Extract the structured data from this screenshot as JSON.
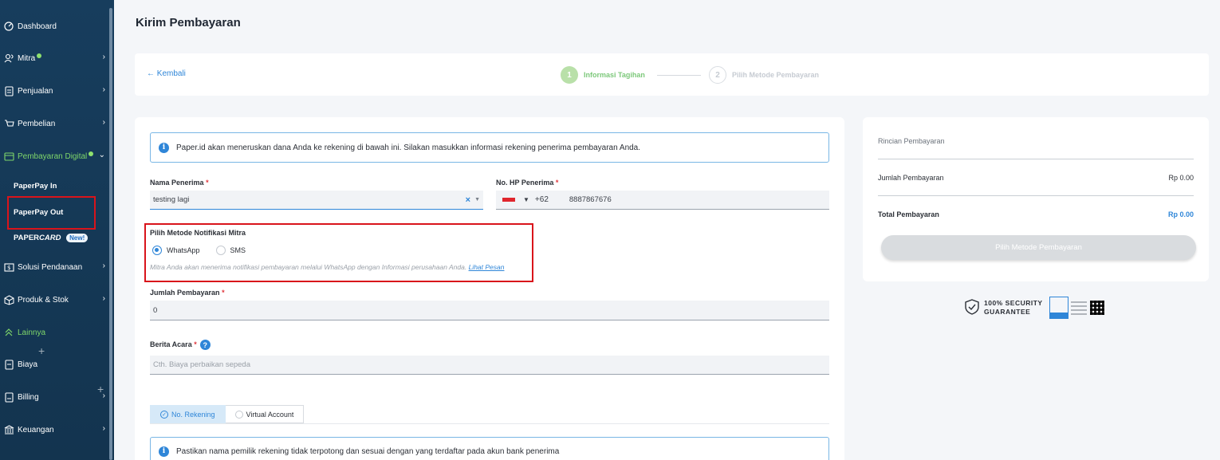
{
  "sidebar": {
    "items": [
      {
        "label": "Dashboard",
        "icon": "dashboard-icon"
      },
      {
        "label": "Mitra",
        "icon": "people-icon"
      },
      {
        "label": "Penjualan",
        "icon": "document-icon"
      },
      {
        "label": "Pembelian",
        "icon": "cart-icon"
      },
      {
        "label": "Pembayaran Digital",
        "icon": "card-icon"
      },
      {
        "label": "Solusi Pendanaan",
        "icon": "funding-icon"
      },
      {
        "label": "Produk & Stok",
        "icon": "box-icon"
      },
      {
        "label": "Lainnya",
        "icon": "chevrons-up-icon"
      },
      {
        "label": "Biaya",
        "icon": "receipt-icon"
      },
      {
        "label": "Billing",
        "icon": "billing-icon"
      },
      {
        "label": "Keuangan",
        "icon": "bank-icon"
      }
    ],
    "subitems": {
      "paperpay_in": "PaperPay In",
      "paperpay_out": "PaperPay Out",
      "papercard_prefix": "PAPER",
      "papercard_suffix": "CARD",
      "new_badge": "New!"
    }
  },
  "page": {
    "title": "Kirim Pembayaran",
    "back_label": "← Kembali",
    "steps": [
      {
        "num": "1",
        "label": "Informasi Tagihan"
      },
      {
        "num": "2",
        "label": "Pilih Metode Pembayaran"
      }
    ]
  },
  "form": {
    "info_text": "Paper.id akan meneruskan dana Anda ke rekening di bawah ini. Silakan masukkan informasi rekening penerima pembayaran Anda.",
    "recipient_name_label": "Nama Penerima",
    "recipient_name_value": "testing lagi",
    "phone_label": "No. HP Penerima",
    "phone_code": "+62",
    "phone_value": "8887867676",
    "notif_label": "Pilih Metode Notifikasi Mitra",
    "notif_options": [
      "WhatsApp",
      "SMS"
    ],
    "notif_note": "Mitra Anda akan menerima notifikasi pembayaran melalui WhatsApp dengan Informasi perusahaan Anda.",
    "notif_link": "Lihat Pesan",
    "amount_label": "Jumlah Pembayaran",
    "amount_value": "0",
    "memo_label": "Berita Acara",
    "memo_placeholder": "Cth. Biaya perbaikan sepeda",
    "account_tabs": [
      "No. Rekening",
      "Virtual Account"
    ],
    "account_info": "Pastikan nama pemilik rekening tidak terpotong dan sesuai dengan yang terdaftar pada akun bank penerima"
  },
  "summary": {
    "title": "Rincian Pembayaran",
    "amount_label": "Jumlah Pembayaran",
    "amount_value": "Rp 0.00",
    "total_label": "Total Pembayaran",
    "total_value": "Rp 0.00",
    "button_label": "Pilih Metode Pembayaran",
    "security_line1": "100% SECURITY",
    "security_line2": "GUARANTEE"
  },
  "colors": {
    "accent": "#2f86d8",
    "sidebar": "#173d5d",
    "active_green": "#7fd66a",
    "highlight_red": "#d9141b"
  }
}
